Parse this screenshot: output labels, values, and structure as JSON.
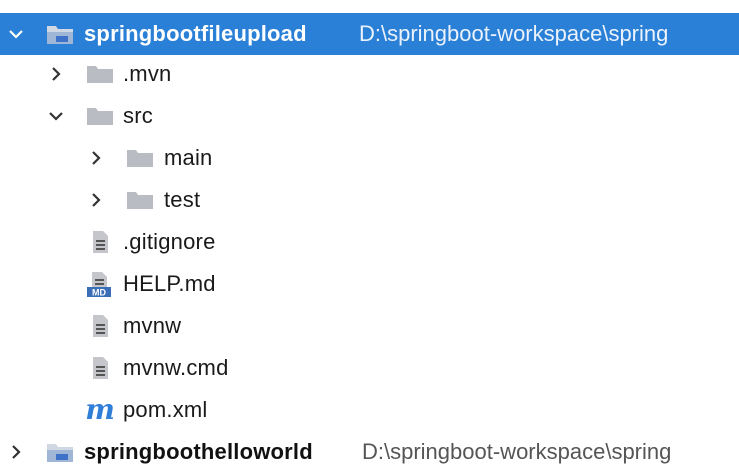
{
  "project_tree": {
    "root": {
      "name": "springbootfileupload",
      "path": "D:\\springboot-workspace\\spring",
      "icon": "module-folder-icon",
      "expanded": true
    },
    "items": [
      {
        "label": ".mvn",
        "icon": "folder-icon",
        "expanded": false
      },
      {
        "label": "src",
        "icon": "folder-icon",
        "expanded": true
      },
      {
        "label": "main",
        "icon": "folder-icon",
        "expanded": false
      },
      {
        "label": "test",
        "icon": "folder-icon",
        "expanded": false
      },
      {
        "label": ".gitignore",
        "icon": "text-file-icon"
      },
      {
        "label": "HELP.md",
        "icon": "markdown-file-icon"
      },
      {
        "label": "mvnw",
        "icon": "text-file-icon"
      },
      {
        "label": "mvnw.cmd",
        "icon": "text-file-icon"
      },
      {
        "label": "pom.xml",
        "icon": "maven-file-icon"
      }
    ],
    "next_module": {
      "name": "springboothelloworld",
      "path": "D:\\springboot-workspace\\spring",
      "icon": "module-folder-icon",
      "expanded": false
    },
    "colors": {
      "selection": "#2a7fd6",
      "folder": "#b9bcc2",
      "module_folder": "#7a9fd0",
      "maven_icon": "#2f7fd8"
    }
  }
}
